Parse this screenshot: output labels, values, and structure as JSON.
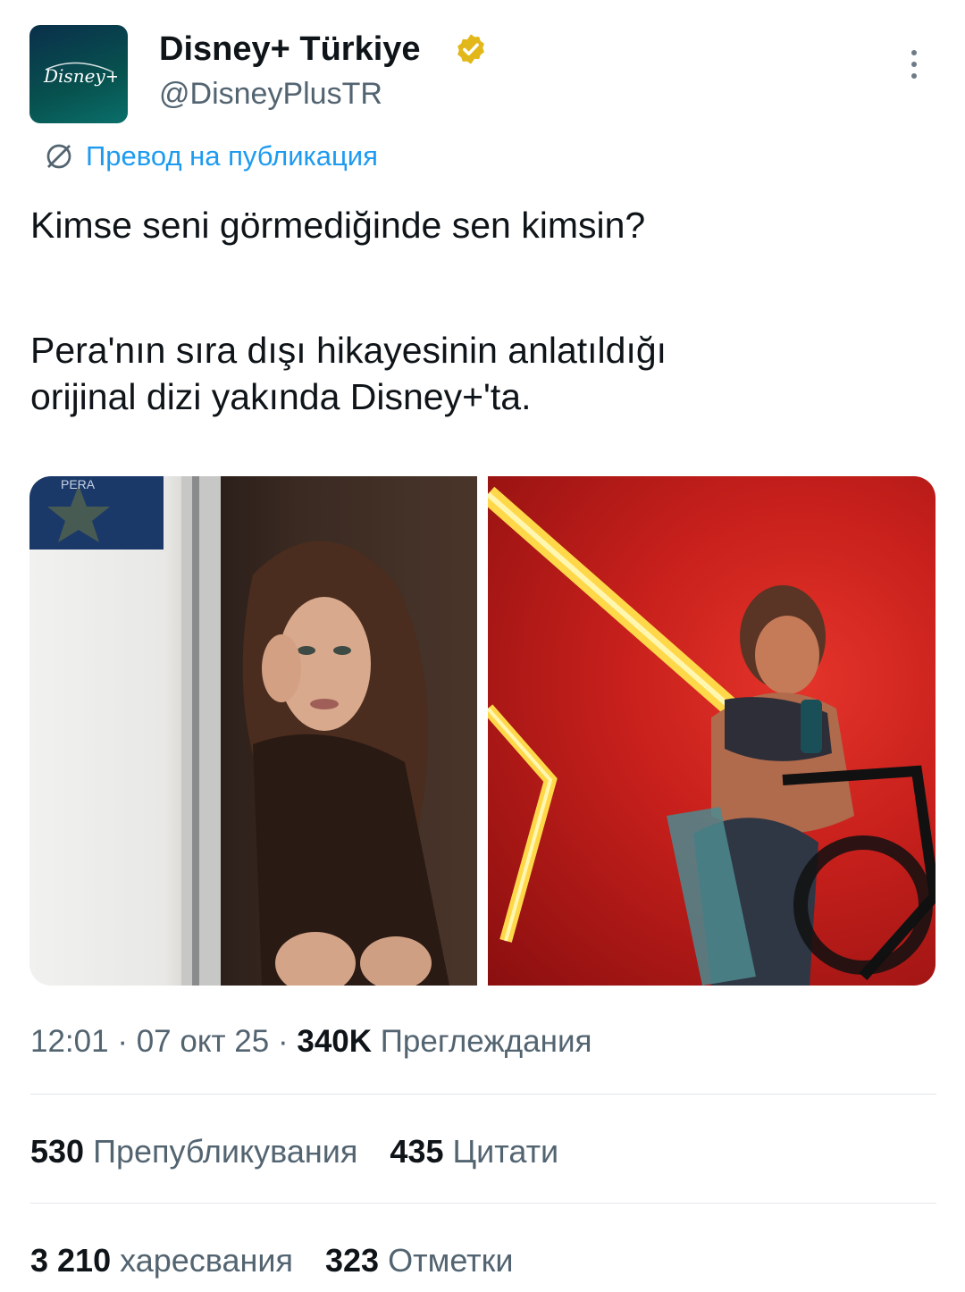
{
  "author": {
    "display_name": "Disney+ Türkiye",
    "handle": "@DisneyPlusTR",
    "avatar_text": "Disney+",
    "verified_color": "#E2B719"
  },
  "translate": {
    "label": "Превод на публикация",
    "icon": "globe-slash-icon",
    "color": "#1D9BF0"
  },
  "tweet": {
    "line1": "Kimse seni görmediğinde sen kimsin?",
    "line2": "Pera'nın sıra dışı hikayesinin anlatıldığı",
    "line3": "orijinal dizi yakında Disney+'ta."
  },
  "media": [
    {
      "label": "Woman in doorway portrait",
      "sign_text": "PERA"
    },
    {
      "label": "Woman on exercise bike under red neon light"
    }
  ],
  "meta": {
    "time": "12:01",
    "sep1": "·",
    "date": "07 окт 25",
    "sep2": "·",
    "views_count": "340K",
    "views_label": "Преглеждания"
  },
  "stats": {
    "reposts_count": "530",
    "reposts_label": "Препубликувания",
    "quotes_count": "435",
    "quotes_label": "Цитати",
    "likes_count": "3 210",
    "likes_label": "харесвания",
    "bookmarks_count": "323",
    "bookmarks_label": "Отметки"
  }
}
